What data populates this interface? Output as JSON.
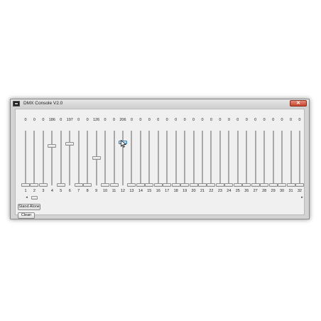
{
  "window": {
    "title": "DMX Console V2.0",
    "close_label": "✕"
  },
  "channels": [
    {
      "number": "1",
      "value": "0",
      "level": 0
    },
    {
      "number": "2",
      "value": "0",
      "level": 0
    },
    {
      "number": "3",
      "value": "0",
      "level": 0
    },
    {
      "number": "4",
      "value": "186",
      "level": 186,
      "label": "186"
    },
    {
      "number": "5",
      "value": "0",
      "level": 0
    },
    {
      "number": "6",
      "value": "197",
      "level": 197
    },
    {
      "number": "7",
      "value": "0",
      "level": 0
    },
    {
      "number": "8",
      "value": "0",
      "level": 0
    },
    {
      "number": "9",
      "value": "126",
      "level": 126
    },
    {
      "number": "10",
      "value": "0",
      "level": 0
    },
    {
      "number": "11",
      "value": "0",
      "level": 0
    },
    {
      "number": "12",
      "value": "206",
      "level": 206,
      "active": true
    },
    {
      "number": "13",
      "value": "0",
      "level": 0
    },
    {
      "number": "14",
      "value": "0",
      "level": 0
    },
    {
      "number": "15",
      "value": "0",
      "level": 0
    },
    {
      "number": "16",
      "value": "0",
      "level": 0
    },
    {
      "number": "17",
      "value": "0",
      "level": 0
    },
    {
      "number": "18",
      "value": "0",
      "level": 0
    },
    {
      "number": "19",
      "value": "0",
      "level": 0
    },
    {
      "number": "20",
      "value": "0",
      "level": 0
    },
    {
      "number": "21",
      "value": "0",
      "level": 0
    },
    {
      "number": "22",
      "value": "0",
      "level": 0
    },
    {
      "number": "23",
      "value": "0",
      "level": 0
    },
    {
      "number": "24",
      "value": "0",
      "level": 0
    },
    {
      "number": "25",
      "value": "0",
      "level": 0
    },
    {
      "number": "26",
      "value": "0",
      "level": 0
    },
    {
      "number": "27",
      "value": "0",
      "level": 0
    },
    {
      "number": "28",
      "value": "0",
      "level": 0
    },
    {
      "number": "29",
      "value": "0",
      "level": 0
    },
    {
      "number": "30",
      "value": "0",
      "level": 0
    },
    {
      "number": "31",
      "value": "0",
      "level": 0
    },
    {
      "number": "32",
      "value": "0",
      "level": 0
    }
  ],
  "scrollbar": {
    "left_arrow": "◂",
    "right_arrow": "▸"
  },
  "buttons": {
    "stand_alone": "Stand Alone",
    "clean": "Clean"
  },
  "icons": {
    "app": "dmx-app-icon",
    "close": "close-icon",
    "cursor": "mouse-pointer-icon"
  },
  "colors": {
    "active_thumb": "#8cc4ee",
    "close_button": "#c6442c"
  }
}
